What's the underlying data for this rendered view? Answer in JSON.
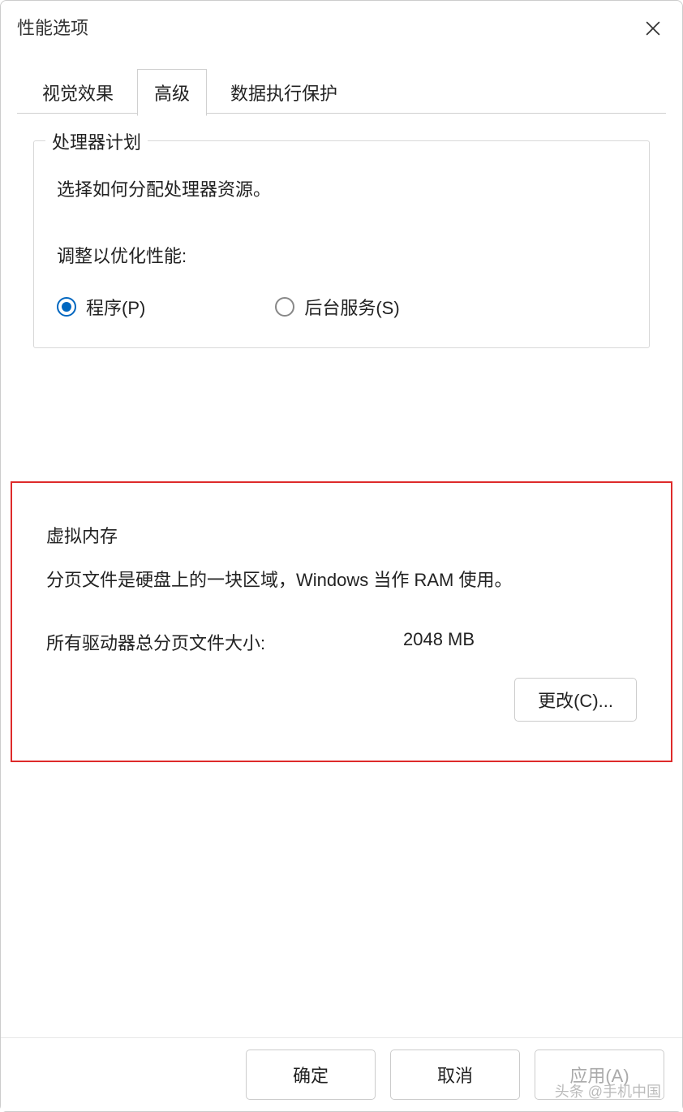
{
  "window": {
    "title": "性能选项"
  },
  "tabs": {
    "visual_effects": "视觉效果",
    "advanced": "高级",
    "dep": "数据执行保护"
  },
  "processor": {
    "group_title": "处理器计划",
    "description": "选择如何分配处理器资源。",
    "adjust_label": "调整以优化性能:",
    "option_programs": "程序(P)",
    "option_background": "后台服务(S)"
  },
  "virtual_memory": {
    "group_title": "虚拟内存",
    "description": "分页文件是硬盘上的一块区域，Windows 当作 RAM 使用。",
    "size_label": "所有驱动器总分页文件大小:",
    "size_value": "2048 MB",
    "change_button": "更改(C)..."
  },
  "buttons": {
    "ok": "确定",
    "cancel": "取消",
    "apply": "应用(A)"
  },
  "watermark": "头条 @手机中国"
}
